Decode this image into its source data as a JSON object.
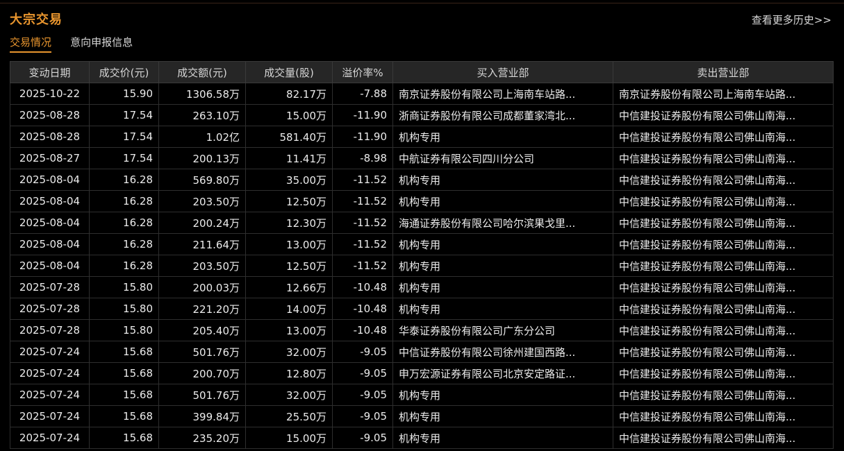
{
  "header": {
    "title": "大宗交易",
    "more_link": "查看更多历史>>"
  },
  "tabs": [
    {
      "label": "交易情况",
      "active": true
    },
    {
      "label": "意向申报信息",
      "active": false
    }
  ],
  "colors": {
    "accent": "#e8952e",
    "negative": "#27c427",
    "header_bg": "#262626",
    "background": "#000000"
  },
  "table": {
    "columns": [
      "变动日期",
      "成交价(元)",
      "成交额(元)",
      "成交量(股)",
      "溢价率%",
      "买入营业部",
      "卖出营业部"
    ],
    "rows": [
      [
        "2025-10-22",
        "15.90",
        "1306.58万",
        "82.17万",
        "-7.88",
        "南京证券股份有限公司上海南车站路...",
        "南京证券股份有限公司上海南车站路..."
      ],
      [
        "2025-08-28",
        "17.54",
        "263.10万",
        "15.00万",
        "-11.90",
        "浙商证券股份有限公司成都董家湾北...",
        "中信建投证券股份有限公司佛山南海..."
      ],
      [
        "2025-08-28",
        "17.54",
        "1.02亿",
        "581.40万",
        "-11.90",
        "机构专用",
        "中信建投证券股份有限公司佛山南海..."
      ],
      [
        "2025-08-27",
        "17.54",
        "200.13万",
        "11.41万",
        "-8.98",
        "中航证券有限公司四川分公司",
        "中信建投证券股份有限公司佛山南海..."
      ],
      [
        "2025-08-04",
        "16.28",
        "569.80万",
        "35.00万",
        "-11.52",
        "机构专用",
        "中信建投证券股份有限公司佛山南海..."
      ],
      [
        "2025-08-04",
        "16.28",
        "203.50万",
        "12.50万",
        "-11.52",
        "机构专用",
        "中信建投证券股份有限公司佛山南海..."
      ],
      [
        "2025-08-04",
        "16.28",
        "200.24万",
        "12.30万",
        "-11.52",
        "海通证券股份有限公司哈尔滨果戈里...",
        "中信建投证券股份有限公司佛山南海..."
      ],
      [
        "2025-08-04",
        "16.28",
        "211.64万",
        "13.00万",
        "-11.52",
        "机构专用",
        "中信建投证券股份有限公司佛山南海..."
      ],
      [
        "2025-08-04",
        "16.28",
        "203.50万",
        "12.50万",
        "-11.52",
        "机构专用",
        "中信建投证券股份有限公司佛山南海..."
      ],
      [
        "2025-07-28",
        "15.80",
        "200.03万",
        "12.66万",
        "-10.48",
        "机构专用",
        "中信建投证券股份有限公司佛山南海..."
      ],
      [
        "2025-07-28",
        "15.80",
        "221.20万",
        "14.00万",
        "-10.48",
        "机构专用",
        "中信建投证券股份有限公司佛山南海..."
      ],
      [
        "2025-07-28",
        "15.80",
        "205.40万",
        "13.00万",
        "-10.48",
        "华泰证券股份有限公司广东分公司",
        "中信建投证券股份有限公司佛山南海..."
      ],
      [
        "2025-07-24",
        "15.68",
        "501.76万",
        "32.00万",
        "-9.05",
        "中信证券股份有限公司徐州建国西路...",
        "中信建投证券股份有限公司佛山南海..."
      ],
      [
        "2025-07-24",
        "15.68",
        "200.70万",
        "12.80万",
        "-9.05",
        "申万宏源证券有限公司北京安定路证...",
        "中信建投证券股份有限公司佛山南海..."
      ],
      [
        "2025-07-24",
        "15.68",
        "501.76万",
        "32.00万",
        "-9.05",
        "机构专用",
        "中信建投证券股份有限公司佛山南海..."
      ],
      [
        "2025-07-24",
        "15.68",
        "399.84万",
        "25.50万",
        "-9.05",
        "机构专用",
        "中信建投证券股份有限公司佛山南海..."
      ],
      [
        "2025-07-24",
        "15.68",
        "235.20万",
        "15.00万",
        "-9.05",
        "机构专用",
        "中信建投证券股份有限公司佛山南海..."
      ]
    ]
  }
}
